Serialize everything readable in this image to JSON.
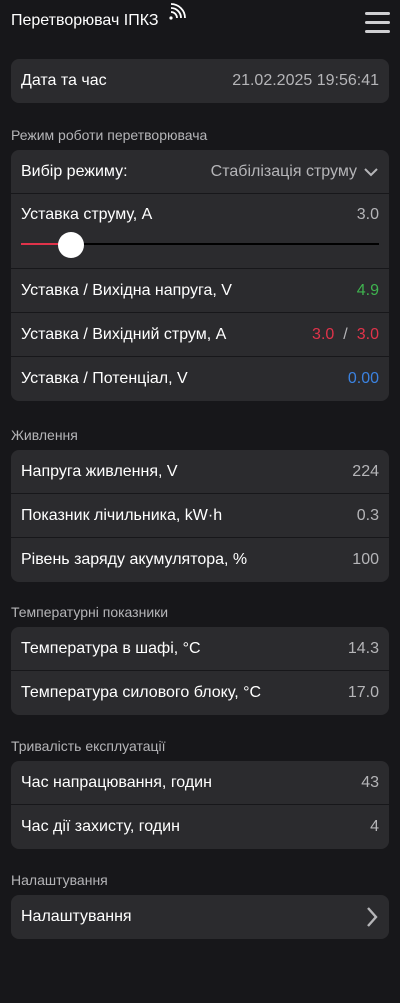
{
  "header": {
    "title": "Перетворювач ІПКЗ"
  },
  "datetime": {
    "label": "Дата та час",
    "value": "21.02.2025 19:56:41"
  },
  "mode_section": {
    "title": "Режим роботи перетворювача",
    "mode_select": {
      "label": "Вибір режиму:",
      "value": "Стабілізація струму"
    },
    "current_setpoint": {
      "label": "Уставка струму, А",
      "value": "3.0",
      "slider_fraction": 0.141
    },
    "voltage": {
      "label": "Уставка / Вихідна напруга, V",
      "value": "4.9"
    },
    "current": {
      "label": "Уставка / Вихідний струм, А",
      "setpoint": "3.0",
      "separator": "/",
      "actual": "3.0"
    },
    "potential": {
      "label": "Уставка / Потенціал, V",
      "value": "0.00"
    }
  },
  "power_section": {
    "title": "Живлення",
    "supply_voltage": {
      "label": "Напруга живлення, V",
      "value": "224"
    },
    "meter": {
      "label": "Показник лічильника, kW·h",
      "value": "0.3"
    },
    "battery": {
      "label": "Рівень заряду акумулятора, %",
      "value": "100"
    }
  },
  "temp_section": {
    "title": "Температурні показники",
    "cabinet": {
      "label": "Температура в шафі, °C",
      "value": "14.3"
    },
    "power_block": {
      "label": "Температура силового блоку, °C",
      "value": "17.0"
    }
  },
  "uptime_section": {
    "title": "Тривалість експлуатації",
    "operating_hours": {
      "label": "Час напрацювання, годин",
      "value": "43"
    },
    "protection_hours": {
      "label": "Час дії захисту, годин",
      "value": "4"
    }
  },
  "settings_section": {
    "title": "Налаштування",
    "link_label": "Налаштування"
  },
  "colors": {
    "background": "#17171a",
    "card": "#2b2b2e",
    "green": "#3fb34f",
    "red": "#e0334a",
    "blue": "#3b82e0"
  },
  "icons": [
    "wifi-icon",
    "menu-icon",
    "chevron-down-icon",
    "chevron-right-icon"
  ]
}
